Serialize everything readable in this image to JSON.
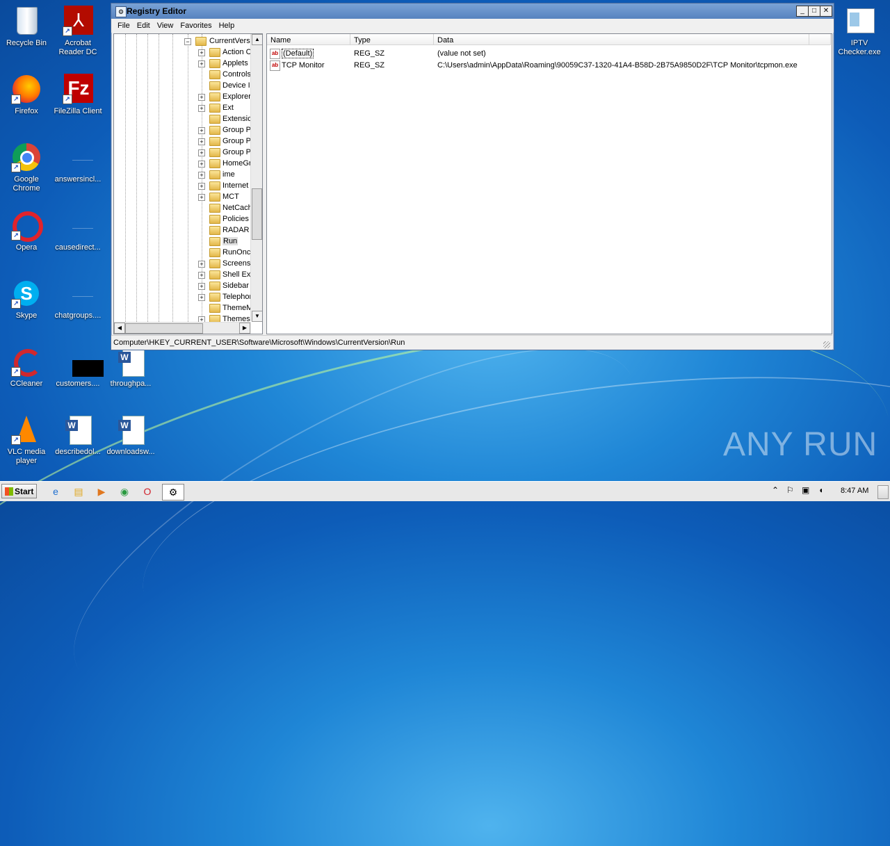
{
  "desktop": {
    "icons": [
      {
        "label": "Recycle Bin",
        "icon": "recycle-bin-icon"
      },
      {
        "label": "Acrobat Reader DC",
        "icon": "acrobat-icon"
      },
      {
        "label": "Firefox",
        "icon": "firefox-icon"
      },
      {
        "label": "FileZilla Client",
        "icon": "filezilla-icon"
      },
      {
        "label": "Google Chrome",
        "icon": "chrome-icon"
      },
      {
        "label": "answersincl...",
        "icon": "blank-file-icon"
      },
      {
        "label": "Opera",
        "icon": "opera-icon"
      },
      {
        "label": "causedirect...",
        "icon": "blank-file-icon"
      },
      {
        "label": "Skype",
        "icon": "skype-icon"
      },
      {
        "label": "chatgroups....",
        "icon": "blank-file-icon"
      },
      {
        "label": "CCleaner",
        "icon": "ccleaner-icon"
      },
      {
        "label": "customers....",
        "icon": "black-file-icon"
      },
      {
        "label": "throughpa...",
        "icon": "word-doc-icon"
      },
      {
        "label": "VLC media player",
        "icon": "vlc-icon"
      },
      {
        "label": "describedol...",
        "icon": "word-doc-icon"
      },
      {
        "label": "downloadsw...",
        "icon": "word-doc-icon"
      },
      {
        "label": "IPTV Checker.exe",
        "icon": "exe-icon"
      }
    ],
    "watermark": "ANY RUN"
  },
  "window": {
    "title": "Registry Editor",
    "menu": [
      "File",
      "Edit",
      "View",
      "Favorites",
      "Help"
    ],
    "tree": {
      "root": "CurrentVers",
      "items": [
        {
          "label": "Action C",
          "expandable": true
        },
        {
          "label": "Applets",
          "expandable": true
        },
        {
          "label": "Controls",
          "expandable": false
        },
        {
          "label": "Device I",
          "expandable": false
        },
        {
          "label": "Explorer",
          "expandable": true
        },
        {
          "label": "Ext",
          "expandable": true
        },
        {
          "label": "Extensic",
          "expandable": false
        },
        {
          "label": "Group Po",
          "expandable": true
        },
        {
          "label": "Group Po",
          "expandable": true
        },
        {
          "label": "Group Po",
          "expandable": true
        },
        {
          "label": "HomeGro",
          "expandable": true
        },
        {
          "label": "ime",
          "expandable": true
        },
        {
          "label": "Internet",
          "expandable": true
        },
        {
          "label": "MCT",
          "expandable": true
        },
        {
          "label": "NetCach",
          "expandable": false
        },
        {
          "label": "Policies",
          "expandable": false
        },
        {
          "label": "RADAR",
          "expandable": false
        },
        {
          "label": "Run",
          "expandable": false,
          "selected": true
        },
        {
          "label": "RunOnce",
          "expandable": false
        },
        {
          "label": "Screens",
          "expandable": true
        },
        {
          "label": "Shell Ext",
          "expandable": true
        },
        {
          "label": "Sidebar",
          "expandable": true
        },
        {
          "label": "Telephor",
          "expandable": true
        },
        {
          "label": "ThemeM",
          "expandable": false
        },
        {
          "label": "Themes",
          "expandable": true
        }
      ]
    },
    "columns": [
      "Name",
      "Type",
      "Data"
    ],
    "values": [
      {
        "name": "(Default)",
        "type": "REG_SZ",
        "data": "(value not set)"
      },
      {
        "name": "TCP Monitor",
        "type": "REG_SZ",
        "data": "C:\\Users\\admin\\AppData\\Roaming\\90059C37-1320-41A4-B58D-2B75A9850D2F\\TCP Monitor\\tcpmon.exe"
      }
    ],
    "status": "Computer\\HKEY_CURRENT_USER\\Software\\Microsoft\\Windows\\CurrentVersion\\Run"
  },
  "taskbar": {
    "start_label": "Start",
    "clock": "8:47 AM"
  }
}
